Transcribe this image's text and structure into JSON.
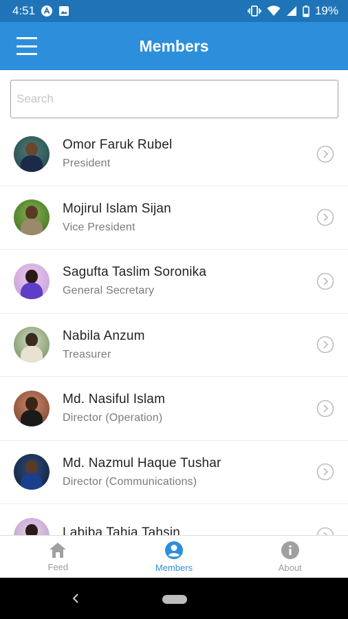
{
  "status_bar": {
    "time": "4:51",
    "battery": "19%",
    "icons": [
      "app-notification-icon",
      "image-notification-icon",
      "vibrate-icon",
      "wifi-icon",
      "signal-icon",
      "battery-icon"
    ]
  },
  "app_bar": {
    "title": "Members",
    "menu_icon": "hamburger-menu-icon",
    "background": "#2d8fdb"
  },
  "search": {
    "placeholder": "Search",
    "value": ""
  },
  "members": [
    {
      "name": "Omor Faruk Rubel",
      "role": "President"
    },
    {
      "name": "Mojirul Islam Sijan",
      "role": "Vice President"
    },
    {
      "name": "Sagufta Taslim Soronika",
      "role": "General Secretary"
    },
    {
      "name": "Nabila Anzum",
      "role": "Treasurer"
    },
    {
      "name": "Md. Nasiful Islam",
      "role": "Director (Operation)"
    },
    {
      "name": "Md. Nazmul Haque Tushar",
      "role": "Director (Communications)"
    },
    {
      "name": "Labiba Tahia Tahsin",
      "role": ""
    }
  ],
  "bottom_nav": {
    "items": [
      {
        "label": "Feed",
        "icon": "home-icon",
        "active": false
      },
      {
        "label": "Members",
        "icon": "account-circle-icon",
        "active": true
      },
      {
        "label": "About",
        "icon": "info-icon",
        "active": false
      }
    ],
    "active_color": "#2d8fdb",
    "inactive_color": "#9b9b9b"
  }
}
